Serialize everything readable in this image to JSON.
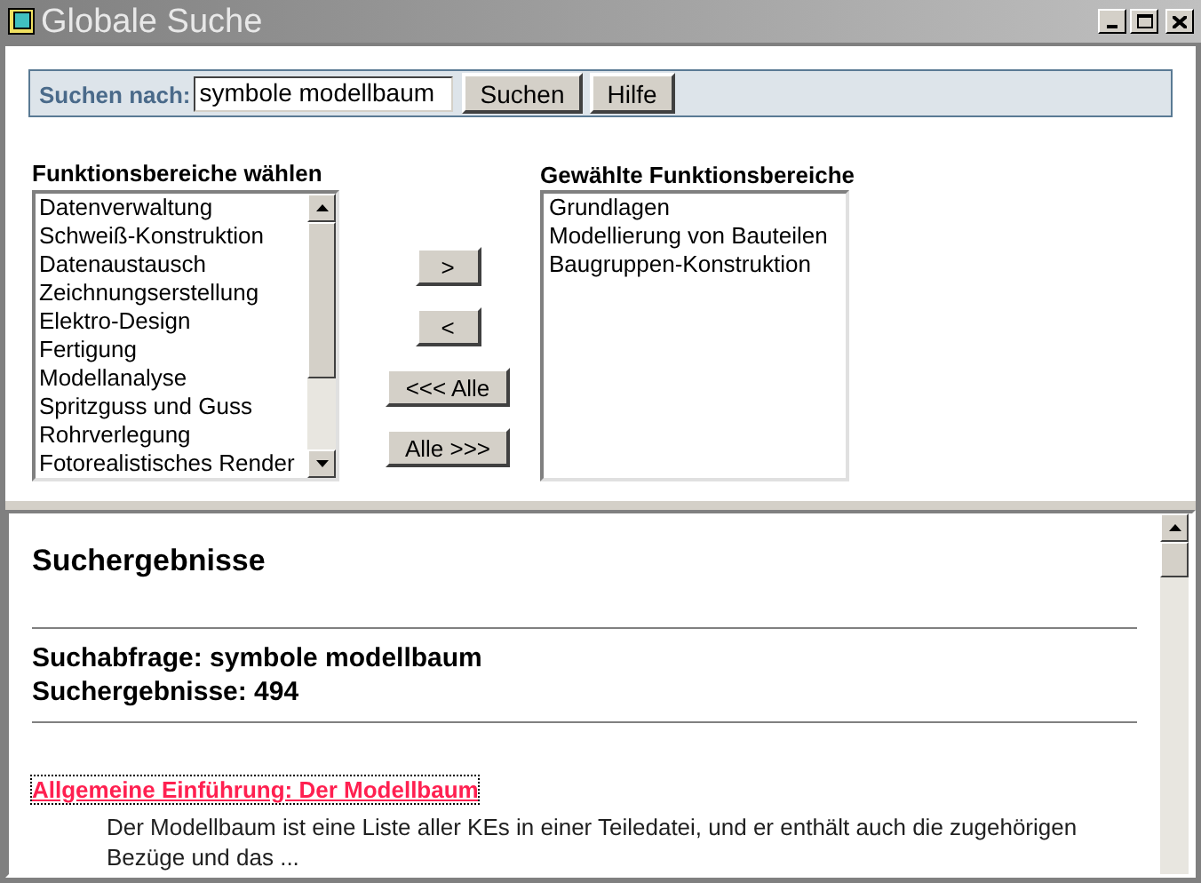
{
  "window": {
    "title": "Globale Suche"
  },
  "search": {
    "label": "Suchen nach:",
    "value": "symbole modellbaum",
    "buttons": [
      "Suchen",
      "Hilfe"
    ]
  },
  "available": {
    "heading": "Funktionsbereiche wählen",
    "items": [
      "Datenverwaltung",
      "Schweiß-Konstruktion",
      "Datenaustausch",
      "Zeichnungserstellung",
      "Elektro-Design",
      "Fertigung",
      "Modellanalyse",
      "Spritzguss und Guss",
      "Rohrverlegung",
      "Fotorealistisches Render"
    ]
  },
  "transfer_buttons": [
    ">",
    "<",
    "<<< Alle",
    "Alle >>>"
  ],
  "chosen": {
    "heading": "Gewählte Funktionsbereiche",
    "items": [
      "Grundlagen",
      "Modellierung von Bauteilen",
      "Baugruppen-Konstruktion"
    ]
  },
  "results": {
    "title": "Suchergebnisse",
    "query": "Suchabfrage: symbole modellbaum",
    "count": "Suchergebnisse: 494",
    "items": [
      {
        "title": "Allgemeine Einführung: Der Modellbaum",
        "snippet": "Der Modellbaum ist eine Liste aller KEs in einer Teiledatei, und er enthält auch die zugehörigen Bezüge und das ..."
      }
    ]
  }
}
